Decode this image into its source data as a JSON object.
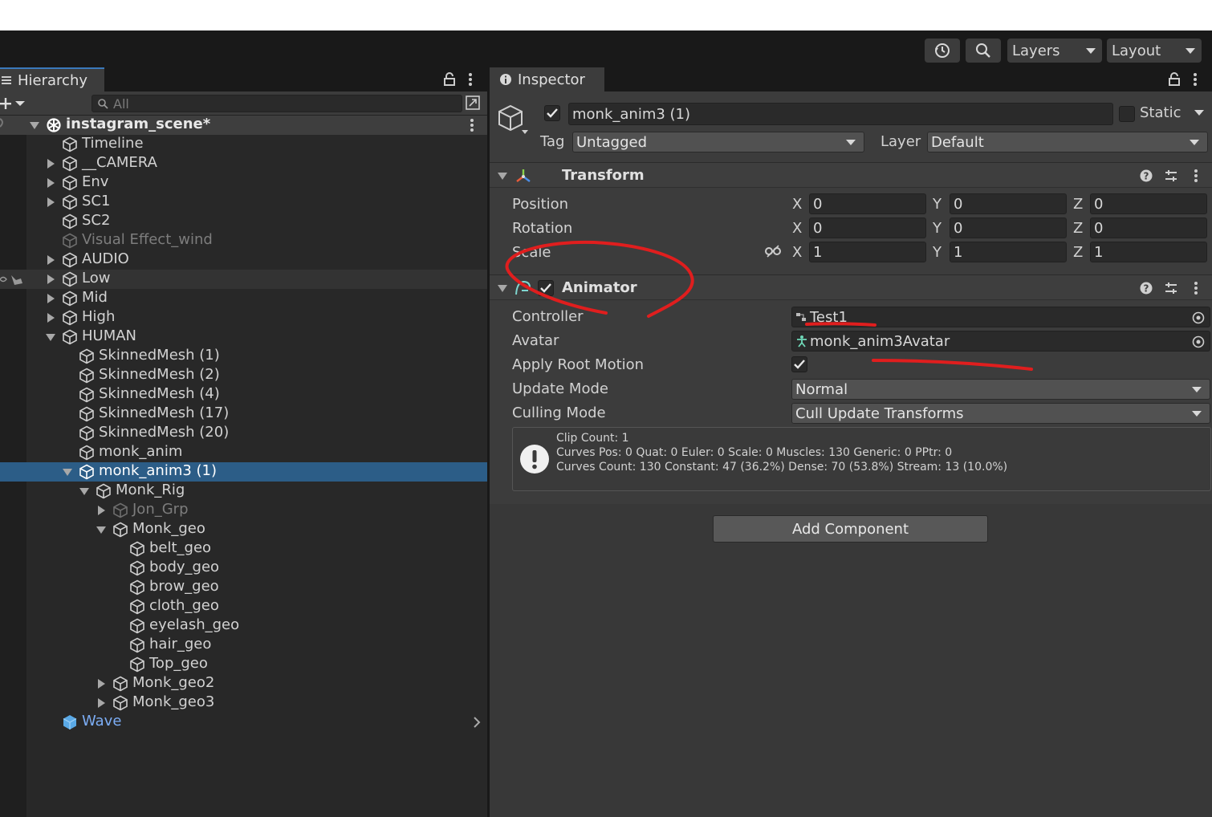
{
  "toolbar": {
    "layers_label": "Layers",
    "layout_label": "Layout"
  },
  "hierarchy": {
    "tab_label": "Hierarchy",
    "search_placeholder": "All",
    "scene_name": "instagram_scene*",
    "items": [
      {
        "label": "Timeline"
      },
      {
        "label": "__CAMERA"
      },
      {
        "label": "Env"
      },
      {
        "label": "SC1"
      },
      {
        "label": "SC2"
      },
      {
        "label": "Visual Effect_wind"
      },
      {
        "label": "AUDIO"
      },
      {
        "label": "Low"
      },
      {
        "label": "Mid"
      },
      {
        "label": "High"
      },
      {
        "label": "HUMAN"
      },
      {
        "label": "SkinnedMesh (1)"
      },
      {
        "label": "SkinnedMesh (2)"
      },
      {
        "label": "SkinnedMesh (4)"
      },
      {
        "label": "SkinnedMesh (17)"
      },
      {
        "label": "SkinnedMesh (20)"
      },
      {
        "label": "monk_anim"
      },
      {
        "label": "monk_anim3 (1)"
      },
      {
        "label": "Monk_Rig"
      },
      {
        "label": "Jon_Grp"
      },
      {
        "label": "Monk_geo"
      },
      {
        "label": "belt_geo"
      },
      {
        "label": "body_geo"
      },
      {
        "label": "brow_geo"
      },
      {
        "label": "cloth_geo"
      },
      {
        "label": "eyelash_geo"
      },
      {
        "label": "hair_geo"
      },
      {
        "label": "Top_geo"
      },
      {
        "label": "Monk_geo2"
      },
      {
        "label": "Monk_geo3"
      },
      {
        "label": "Wave"
      }
    ]
  },
  "inspector": {
    "tab_label": "Inspector",
    "object_name": "monk_anim3 (1)",
    "static_label": "Static",
    "tag_label": "Tag",
    "tag_value": "Untagged",
    "layer_label": "Layer",
    "layer_value": "Default",
    "transform": {
      "title": "Transform",
      "position_label": "Position",
      "rotation_label": "Rotation",
      "scale_label": "Scale",
      "axis_x": "X",
      "axis_y": "Y",
      "axis_z": "Z",
      "position": {
        "x": "0",
        "y": "0",
        "z": "0"
      },
      "rotation": {
        "x": "0",
        "y": "0",
        "z": "0"
      },
      "scale": {
        "x": "1",
        "y": "1",
        "z": "1"
      }
    },
    "animator": {
      "title": "Animator",
      "controller_label": "Controller",
      "controller_value": "Test1",
      "avatar_label": "Avatar",
      "avatar_value": "monk_anim3Avatar",
      "apply_root_motion_label": "Apply Root Motion",
      "apply_root_motion": true,
      "update_mode_label": "Update Mode",
      "update_mode_value": "Normal",
      "culling_mode_label": "Culling Mode",
      "culling_mode_value": "Cull Update Transforms",
      "info_lines": [
        "Clip Count: 1",
        "Curves Pos: 0 Quat: 0 Euler: 0 Scale: 0 Muscles: 130 Generic: 0 PPtr: 0",
        "Curves Count: 130 Constant: 47 (36.2%) Dense: 70 (53.8%) Stream: 13 (10.0%)"
      ]
    },
    "add_component_label": "Add Component"
  },
  "colors": {
    "selection": "#2c5d87",
    "annotation": "#e01e1e",
    "prefab_blue": "#7cadf5"
  }
}
